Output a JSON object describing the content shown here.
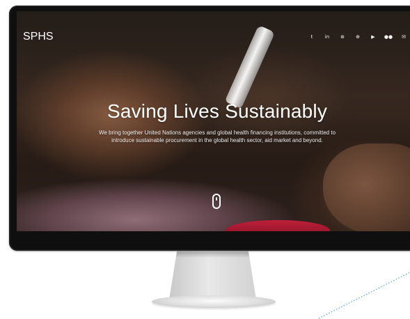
{
  "header": {
    "logo": "SPHS"
  },
  "hero": {
    "headline": "Saving Lives Sustainably",
    "subtext": "We bring together United Nations agencies and global health financing institutions, committed to introduce sustainable procurement in the global health sector, aid market and beyond."
  },
  "social": {
    "icons": [
      {
        "name": "twitter-icon",
        "glyph": "t"
      },
      {
        "name": "linkedin-icon",
        "glyph": "in"
      },
      {
        "name": "skype-icon",
        "glyph": "⊛"
      },
      {
        "name": "rss-icon",
        "glyph": "⊕"
      },
      {
        "name": "youtube-icon",
        "glyph": "▶"
      },
      {
        "name": "flickr-icon",
        "glyph": "●●"
      },
      {
        "name": "email-icon",
        "glyph": "✉"
      }
    ]
  },
  "colors": {
    "monitor": "#0f0f0f",
    "text": "#ffffff",
    "accent": "#2f97ce"
  }
}
